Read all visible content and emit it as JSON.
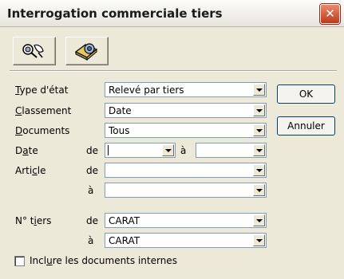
{
  "window": {
    "title": "Interrogation commerciale tiers",
    "close_glyph": "✕"
  },
  "toolbar": {
    "buttons": [
      {
        "icon": "search-binoculars-icon"
      },
      {
        "icon": "disk-settings-icon"
      }
    ]
  },
  "form": {
    "type_etat": {
      "label_u": "T",
      "label_rest": "ype d'état",
      "value": "Relevé par tiers"
    },
    "classement": {
      "label_u": "C",
      "label_rest": "lassement",
      "value": "Date"
    },
    "documents": {
      "label_u": "D",
      "label_rest": "ocuments",
      "value": "Tous"
    },
    "date": {
      "label_pre": "D",
      "label_u": "a",
      "label_rest": "te",
      "from_word": "de",
      "from_value": "",
      "to_word": "à",
      "to_value": ""
    },
    "article": {
      "label_pre": "Arti",
      "label_u": "c",
      "label_rest": "le",
      "from_word": "de",
      "from_value": "",
      "to_word": "à",
      "to_value": ""
    },
    "tiers": {
      "label_pre": "N° t",
      "label_u": "i",
      "label_rest": "ers",
      "from_word": "de",
      "from_value": "CARAT",
      "to_word": "à",
      "to_value": "CARAT"
    },
    "include_internal": {
      "label_pre": "Incl",
      "label_u": "u",
      "label_rest": "re les documents internes",
      "checked": false
    }
  },
  "actions": {
    "ok_label": "OK",
    "cancel_label": "Annuler"
  }
}
